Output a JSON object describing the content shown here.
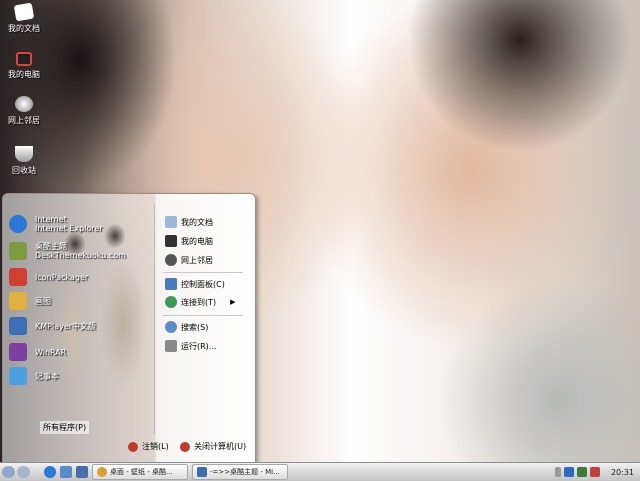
{
  "desktop": {
    "icons": [
      {
        "label": "我的文档",
        "icon": "my-documents-icon",
        "color": "#ffffff"
      },
      {
        "label": "我的电脑",
        "icon": "my-computer-icon",
        "color": "#e04040"
      },
      {
        "label": "网上邻居",
        "icon": "network-icon",
        "color": "#dddddd"
      },
      {
        "label": "回收站",
        "icon": "recycle-bin-icon",
        "color": "#cfcfcf"
      }
    ]
  },
  "start_menu": {
    "left_items": [
      {
        "label": "Internet\nInternet Explorer",
        "icon": "ie-icon",
        "color": "#2b78d6"
      },
      {
        "label": "桌酷主题DeskThemekuoku.com",
        "icon": "deskkuoku-icon",
        "color": "#7c9c3e"
      },
      {
        "label": "IconPackager",
        "icon": "iconpackager-icon",
        "color": "#d04030"
      },
      {
        "label": "画图",
        "icon": "paint-icon",
        "color": "#e0b040"
      },
      {
        "label": "KMPlayer中文版",
        "icon": "kmplayer-icon",
        "color": "#3a6fb6"
      },
      {
        "label": "WinRAR",
        "icon": "winrar-icon",
        "color": "#7a3fa0"
      },
      {
        "label": "记事本",
        "icon": "notepad-icon",
        "color": "#4aa0e0"
      }
    ],
    "all_programs": "所有程序(P)",
    "right_items": [
      {
        "label": "我的文档",
        "icon": "my-documents-icon",
        "color": "#9bb8d8",
        "arrow": ""
      },
      {
        "label": "我的电脑",
        "icon": "my-computer-icon",
        "color": "#333333",
        "arrow": ""
      },
      {
        "label": "网上邻居",
        "icon": "network-icon",
        "color": "#555555",
        "arrow": ""
      },
      {
        "label": "控制面板(C)",
        "icon": "control-panel-icon",
        "color": "#4a7ab8",
        "arrow": ""
      },
      {
        "label": "连接到(T)",
        "icon": "connect-icon",
        "color": "#3a9a5a",
        "arrow": "▶"
      },
      {
        "label": "搜索(S)",
        "icon": "search-icon",
        "color": "#5a8ac8",
        "arrow": ""
      },
      {
        "label": "运行(R)...",
        "icon": "run-icon",
        "color": "#8a8a8a",
        "arrow": ""
      }
    ],
    "logoff": "注销(L)",
    "shutdown": "关闭计算机(U)"
  },
  "taskbar": {
    "tasks": [
      {
        "label": "桌面 - 壁纸 - 桌酷...",
        "icon": "chrome-icon",
        "color": "#d9a030"
      },
      {
        "label": "-=>>桌酷主题 - Mi...",
        "icon": "word-icon",
        "color": "#3a6fb6"
      }
    ],
    "clock": "20:31"
  }
}
